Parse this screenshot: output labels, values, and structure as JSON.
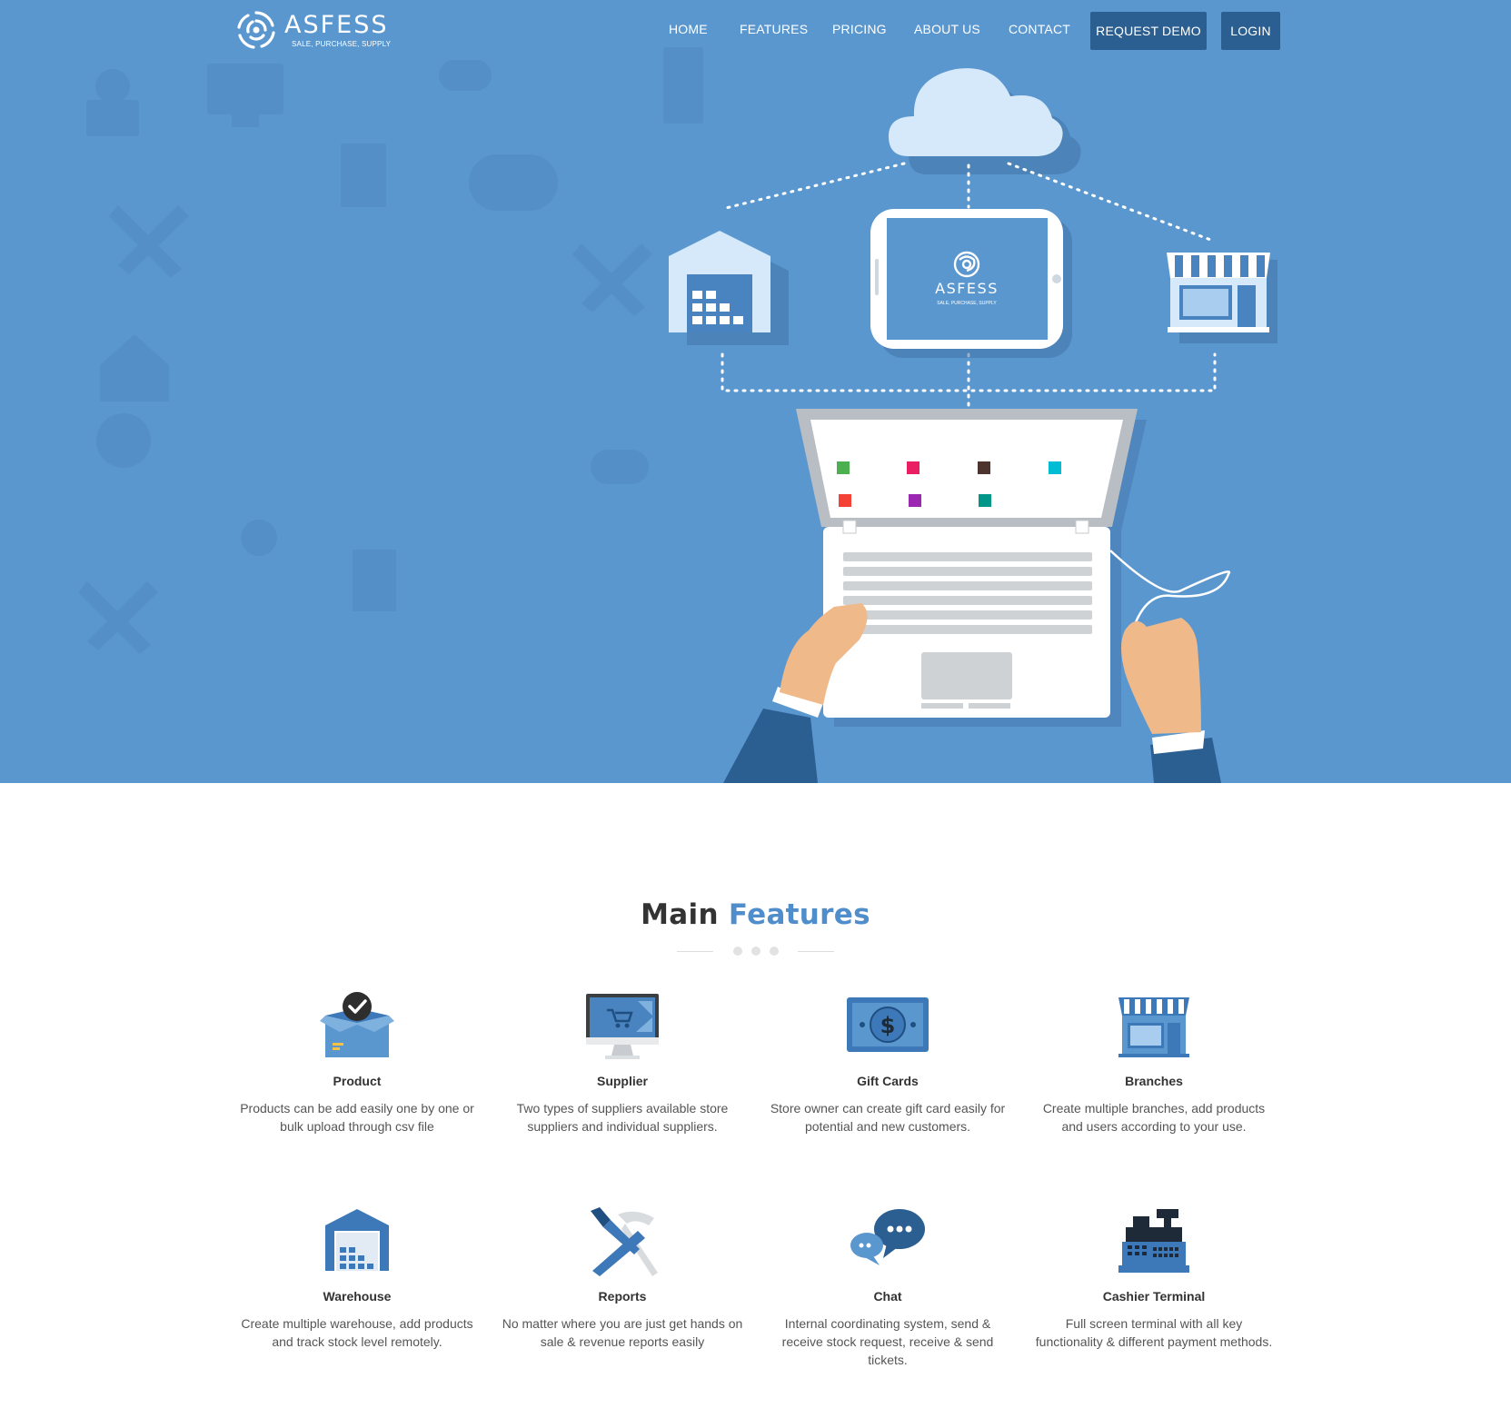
{
  "brand": {
    "name": "ASFESS",
    "tagline": "SALE, PURCHASE, SUPPLY"
  },
  "nav": {
    "links": [
      "HOME",
      "FEATURES",
      "PRICING",
      "ABOUT US",
      "CONTACT"
    ],
    "request_demo": "REQUEST DEMO",
    "login": "LOGIN"
  },
  "hero": {
    "tablet_brand": "ASFESS",
    "tablet_tagline": "SALE, PURCHASE, SUPPLY"
  },
  "features": {
    "title_main": "Main",
    "title_accent": "Features",
    "items": [
      {
        "icon": "product-box-icon",
        "title": "Product",
        "desc": "Products can be add easily one by one or bulk upload through csv file"
      },
      {
        "icon": "supplier-monitor-icon",
        "title": "Supplier",
        "desc": "Two types of suppliers available store suppliers and individual suppliers."
      },
      {
        "icon": "gift-card-icon",
        "title": "Gift Cards",
        "desc": "Store owner can create gift card easily for potential and new customers."
      },
      {
        "icon": "branch-store-icon",
        "title": "Branches",
        "desc": "Create multiple branches, add products and users according to your use."
      },
      {
        "icon": "warehouse-icon",
        "title": "Warehouse",
        "desc": "Create multiple warehouse, add products and track stock level remotely."
      },
      {
        "icon": "reports-tools-icon",
        "title": "Reports",
        "desc": "No matter where you are just get hands on sale & revenue reports easily"
      },
      {
        "icon": "chat-bubbles-icon",
        "title": "Chat",
        "desc": "Internal coordinating system, send & receive stock request, receive & send tickets."
      },
      {
        "icon": "cash-register-icon",
        "title": "Cashier Terminal",
        "desc": "Full screen terminal with all key functionality & different payment methods."
      }
    ]
  },
  "colors": {
    "hero_bg": "#5b97cf",
    "nav_button": "#2c5f91",
    "accent": "#4f8dcb",
    "icon_blue": "#3d78b8"
  }
}
